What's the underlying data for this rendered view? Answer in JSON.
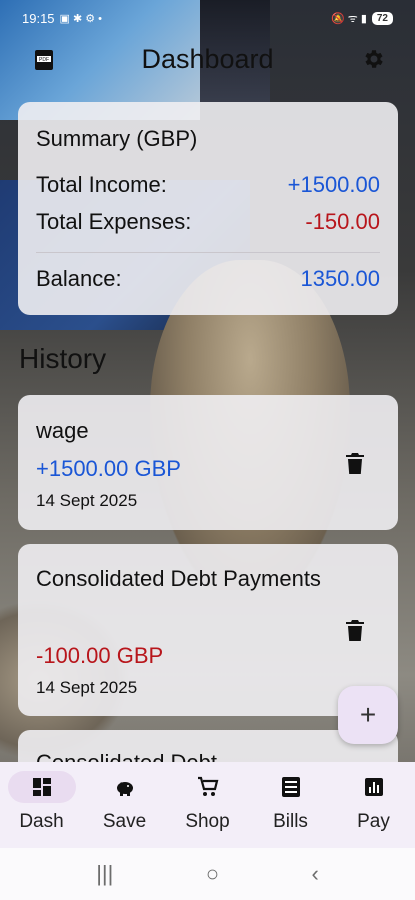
{
  "status_bar": {
    "time": "19:15",
    "battery": "72"
  },
  "app": {
    "title": "Dashboard"
  },
  "summary": {
    "title": "Summary (GBP)",
    "income_label": "Total Income:",
    "income_value": "+1500.00",
    "expenses_label": "Total Expenses:",
    "expenses_value": "-150.00",
    "balance_label": "Balance:",
    "balance_value": "1350.00"
  },
  "history": {
    "title": "History",
    "entries": [
      {
        "name": "wage",
        "amount": "+1500.00 GBP",
        "date": "14 Sept 2025"
      },
      {
        "name": "Consolidated Debt Payments",
        "amount": "-100.00 GBP",
        "date": "14 Sept 2025"
      },
      {
        "name": "Consolidated Debt"
      }
    ]
  },
  "fab": {
    "label": "+"
  },
  "nav": {
    "items": [
      {
        "label": "Dash",
        "icon": "dashboard-icon",
        "active": true
      },
      {
        "label": "Save",
        "icon": "piggy-bank-icon"
      },
      {
        "label": "Shop",
        "icon": "shopping-cart-icon"
      },
      {
        "label": "Bills",
        "icon": "receipt-icon"
      },
      {
        "label": "Pay",
        "icon": "bar-chart-icon"
      }
    ]
  },
  "colors": {
    "income": "#1a56d6",
    "expense": "#b8151b",
    "nav_active": "#e9dcf0"
  }
}
